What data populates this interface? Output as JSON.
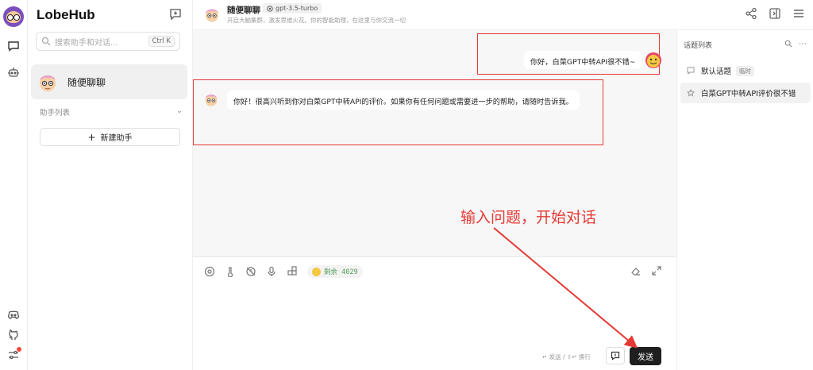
{
  "app": {
    "brand": "LobeHub"
  },
  "sidebar": {
    "search_placeholder": "搜索助手和对话...",
    "search_shortcut": "Ctrl K",
    "active_session": "随便聊聊",
    "assistants_header": "助手列表",
    "new_assistant_label": "新建助手"
  },
  "header": {
    "title": "随便聊聊",
    "model": "gpt-3.5-turbo",
    "description": "开启大脑集群，激发思维火花。你的智能助理，在这里与你交流一切"
  },
  "messages": [
    {
      "role": "user",
      "text": "你好，白菜GPT中转API很不错~"
    },
    {
      "role": "assistant",
      "text": "你好！很高兴听到你对白菜GPT中转API的评价。如果你有任何问题或需要进一步的帮助，请随时告诉我。"
    }
  ],
  "input": {
    "token_label": "剩余 4029",
    "hint": "↵ 发送 / ⇧↵ 换行",
    "send_label": "发送"
  },
  "topics": {
    "header": "话题列表",
    "items": [
      {
        "label": "默认话题",
        "tag": "临时"
      },
      {
        "label": "白菜GPT中转API评价很不错",
        "tag": ""
      }
    ]
  },
  "annotation": {
    "text": "输入问题，开始对话",
    "color": "#e53935"
  },
  "colors": {
    "accent": "#1f1f1f",
    "highlight": "#e53935",
    "chat_bg": "#f7f7f7"
  }
}
